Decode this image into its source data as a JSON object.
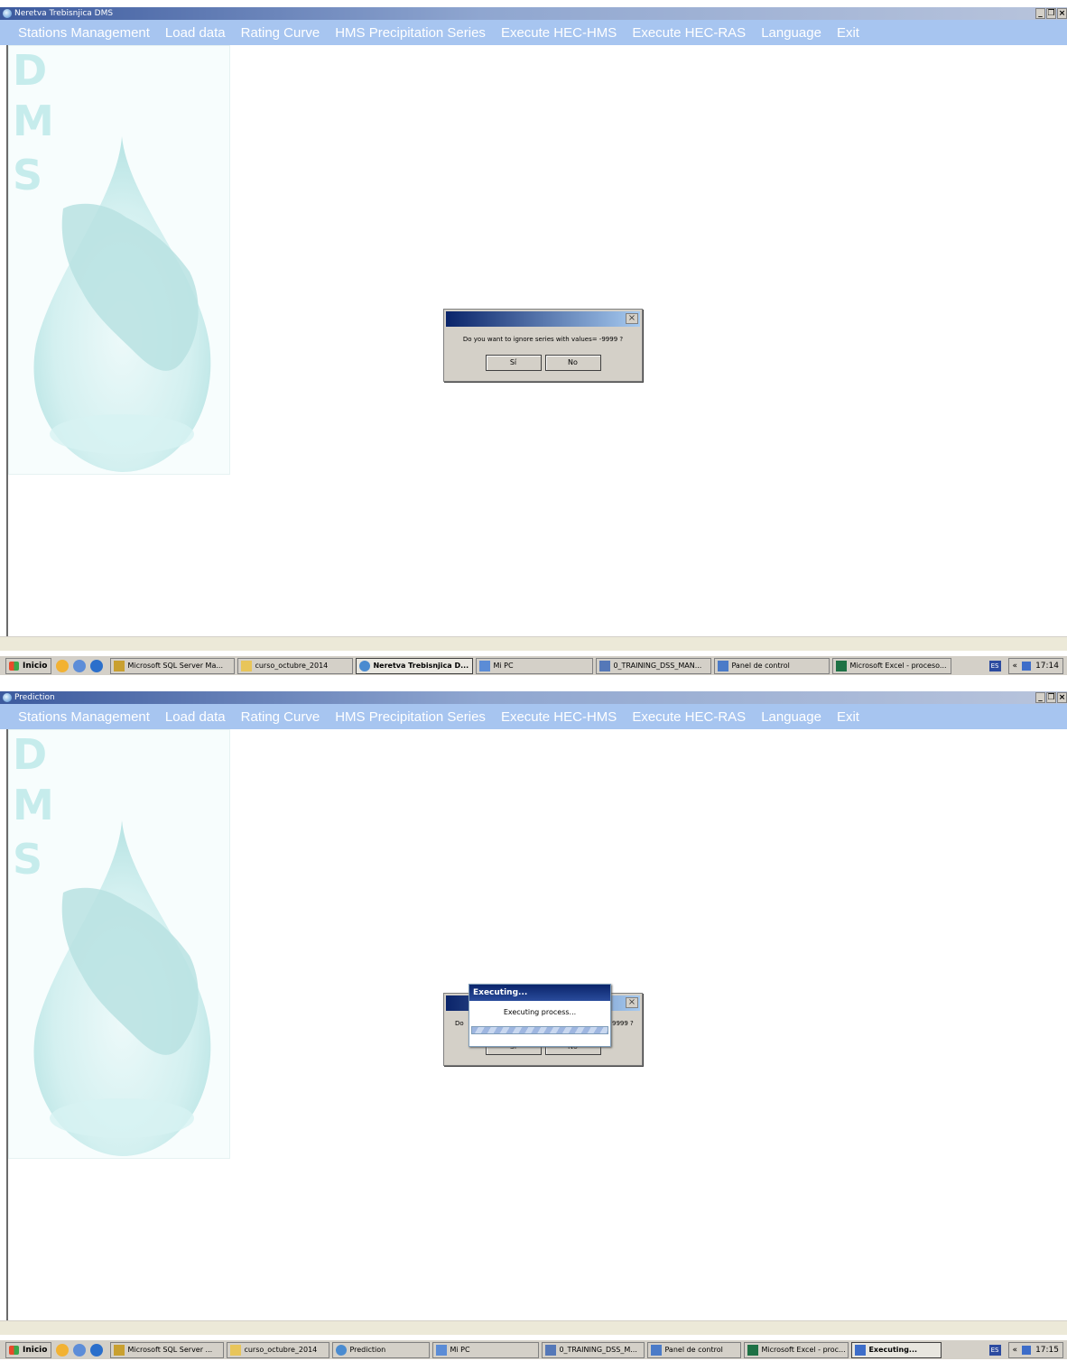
{
  "screens": [
    {
      "window_title": "Neretva Trebisnjica DMS",
      "menu": [
        "Stations Management",
        "Load data",
        "Rating Curve",
        "HMS Precipitation Series",
        "Execute HEC-HMS",
        "Execute HEC-RAS",
        "Language",
        "Exit"
      ],
      "logo_letters": [
        "D",
        "M",
        "S"
      ],
      "dialog": {
        "message": "Do you want to ignore series with values= -9999 ?",
        "yes_label": "Sí",
        "no_label": "No",
        "close_label": "×"
      },
      "taskbar": {
        "start_label": "Inicio",
        "tasks": [
          {
            "label": "Microsoft SQL Server Ma...",
            "icon": "sql-server-icon",
            "active": false
          },
          {
            "label": "curso_octubre_2014",
            "icon": "folder-icon",
            "active": false
          },
          {
            "label": "Neretva Trebisnjica D...",
            "icon": "app-icon",
            "active": true
          },
          {
            "label": "Mi PC",
            "icon": "computer-icon",
            "active": false
          },
          {
            "label": "0_TRAINING_DSS_MAN...",
            "icon": "document-icon",
            "active": false
          },
          {
            "label": "Panel de control",
            "icon": "control-panel-icon",
            "active": false
          },
          {
            "label": "Microsoft Excel - proceso...",
            "icon": "excel-icon",
            "active": false
          }
        ],
        "language": "ES",
        "clock": "17:14"
      }
    },
    {
      "window_title": "Prediction",
      "menu": [
        "Stations Management",
        "Load data",
        "Rating Curve",
        "HMS Precipitation Series",
        "Execute HEC-HMS",
        "Execute HEC-RAS",
        "Language",
        "Exit"
      ],
      "logo_letters": [
        "D",
        "M",
        "S"
      ],
      "dialog": {
        "message_left": "Do",
        "message_right": "9999 ?",
        "yes_label": "Sí",
        "no_label": "No",
        "close_label": "×"
      },
      "exec_dialog": {
        "title": "Executing...",
        "message": "Executing process..."
      },
      "taskbar": {
        "start_label": "Inicio",
        "tasks": [
          {
            "label": "Microsoft SQL Server ...",
            "icon": "sql-server-icon",
            "active": false
          },
          {
            "label": "curso_octubre_2014",
            "icon": "folder-icon",
            "active": false
          },
          {
            "label": "Prediction",
            "icon": "app-icon",
            "active": false
          },
          {
            "label": "Mi PC",
            "icon": "computer-icon",
            "active": false
          },
          {
            "label": "0_TRAINING_DSS_M...",
            "icon": "document-icon",
            "active": false
          },
          {
            "label": "Panel de control",
            "icon": "control-panel-icon",
            "active": false
          },
          {
            "label": "Microsoft Excel - proc...",
            "icon": "excel-icon",
            "active": false
          },
          {
            "label": "Executing...",
            "icon": "executing-icon",
            "active": true
          }
        ],
        "language": "ES",
        "clock": "17:15"
      }
    }
  ],
  "colors": {
    "menubar": "#a7c5f0",
    "titlebar": "#3c5a9e",
    "dialog_title": "#0a246a",
    "logo_tint": "#c6ecec"
  }
}
